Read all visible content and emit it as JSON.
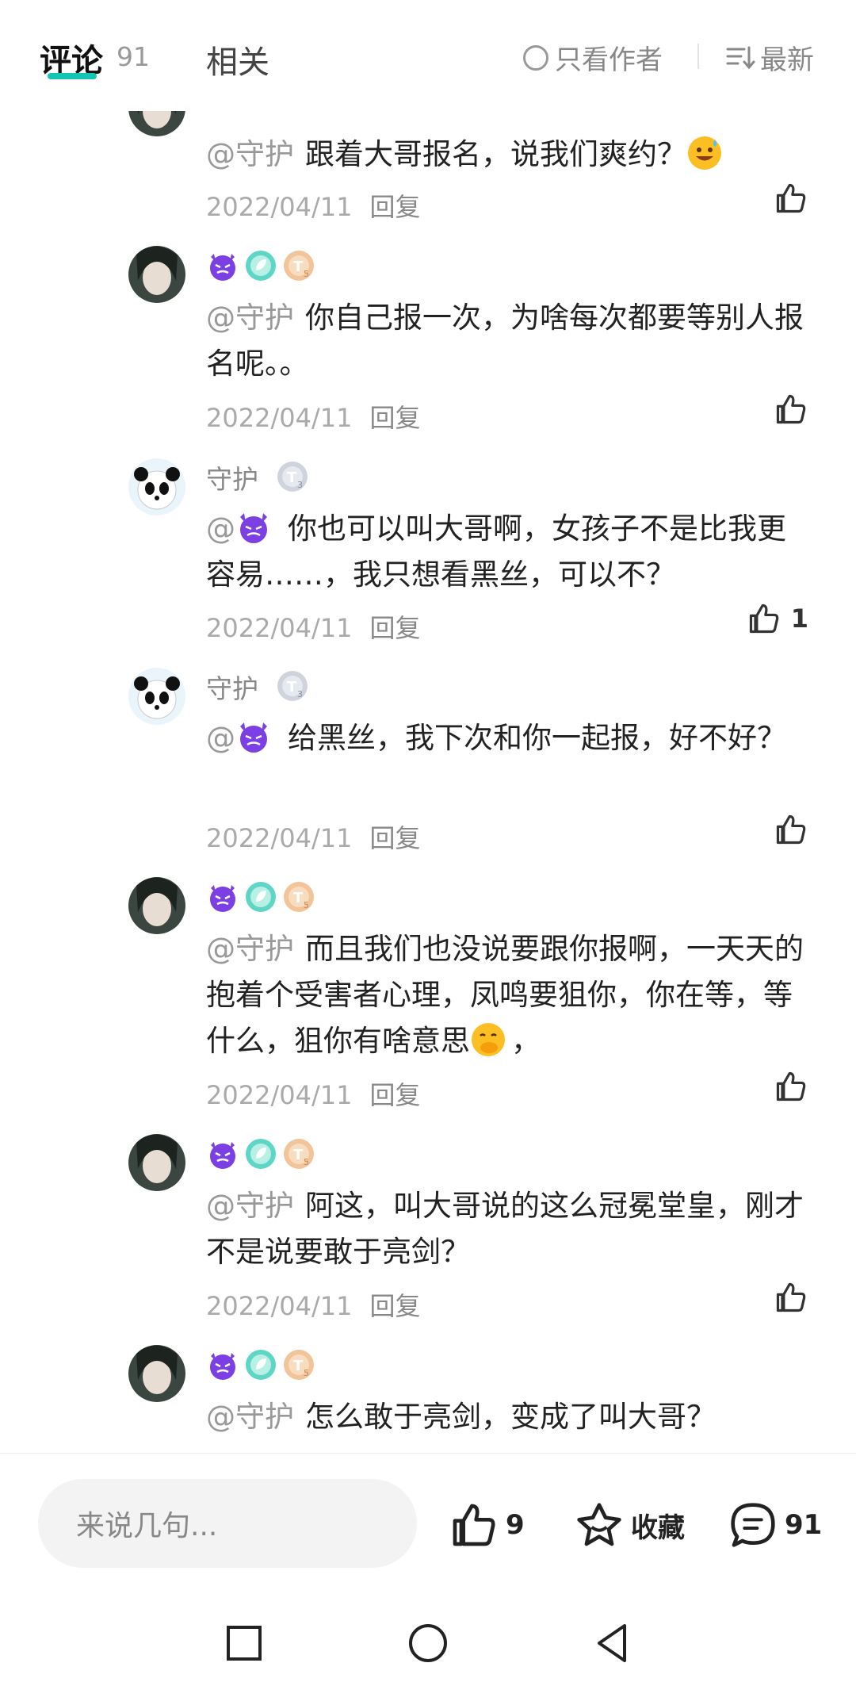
{
  "tabs": {
    "comments_label": "评论",
    "comments_count": "91",
    "related_label": "相关",
    "author_only_label": "只看作者",
    "sort_label": "最新"
  },
  "comments": [
    {
      "avatar": "portrait",
      "name": "",
      "badges": [
        "devil",
        "leaf",
        "coin-t5"
      ],
      "mention": "@守护",
      "text": "跟着大哥报名，说我们爽约？",
      "date": "2022/04/11",
      "reply": "回复",
      "likes": ""
    },
    {
      "avatar": "portrait",
      "name": "",
      "badges": [
        "devil",
        "leaf",
        "coin-t5"
      ],
      "mention": "@守护",
      "text": "你自己报一次，为啥每次都要等别人报名呢。。",
      "date": "2022/04/11",
      "reply": "回复",
      "likes": ""
    },
    {
      "avatar": "panda",
      "name": "守护",
      "badges": [
        "coin-t3"
      ],
      "mention": "@",
      "text": "你也可以叫大哥啊，女孩子不是比我更容易……，我只想看黑丝，可以不？",
      "date": "2022/04/11",
      "reply": "回复",
      "likes": "1"
    },
    {
      "avatar": "panda",
      "name": "守护",
      "badges": [
        "coin-t3"
      ],
      "mention": "@",
      "text": "给黑丝，我下次和你一起报，好不好？",
      "date": "2022/04/11",
      "reply": "回复",
      "likes": ""
    },
    {
      "avatar": "portrait",
      "name": "",
      "badges": [
        "devil",
        "leaf",
        "coin-t5"
      ],
      "mention": "@守护",
      "text": "而且我们也没说要跟你报啊，一天天的抱着个受害者心理，凤鸣要狙你，你在等，等什么，狙你有啥意思",
      "date": "2022/04/11",
      "reply": "回复",
      "likes": ""
    },
    {
      "avatar": "portrait",
      "name": "",
      "badges": [
        "devil",
        "leaf",
        "coin-t5"
      ],
      "mention": "@守护",
      "text": "阿这，叫大哥说的这么冠冕堂皇，刚才不是说要敢于亮剑？",
      "date": "2022/04/11",
      "reply": "回复",
      "likes": ""
    },
    {
      "avatar": "portrait",
      "name": "",
      "badges": [
        "devil",
        "leaf",
        "coin-t5"
      ],
      "mention": "@守护",
      "text": "怎么敢于亮剑，变成了叫大哥？",
      "date": "",
      "reply": "",
      "likes": ""
    }
  ],
  "bottom": {
    "input_placeholder": "来说几句...",
    "like_count": "9",
    "favorite_label": "收藏",
    "comment_count": "91"
  },
  "colors": {
    "accent": "#13c6b3",
    "devil": "#7b3fe4"
  }
}
